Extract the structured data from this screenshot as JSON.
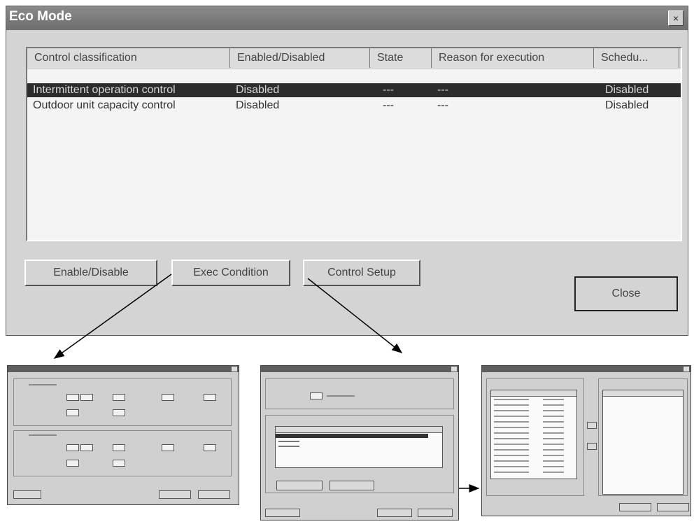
{
  "window": {
    "title": "Eco Mode",
    "close_glyph": "×"
  },
  "list": {
    "columns": [
      "Control classification",
      "Enabled/Disabled",
      "State",
      "Reason for execution",
      "Schedu..."
    ],
    "rows": [
      {
        "classification": "Intermittent operation control",
        "enabled": "Disabled",
        "state": "---",
        "reason": "---",
        "schedule": "Disabled",
        "selected": true
      },
      {
        "classification": "Outdoor unit capacity control",
        "enabled": "Disabled",
        "state": "---",
        "reason": "---",
        "schedule": "Disabled",
        "selected": false
      }
    ]
  },
  "buttons": {
    "enable_disable": "Enable/Disable",
    "exec_condition": "Exec Condition",
    "control_setup": "Control Setup",
    "close": "Close"
  },
  "colors": {
    "dialog_face": "#d4d4d4",
    "titlebar": "#6e6e6e",
    "selection": "#2c2c2c",
    "arrow": "#000000"
  }
}
